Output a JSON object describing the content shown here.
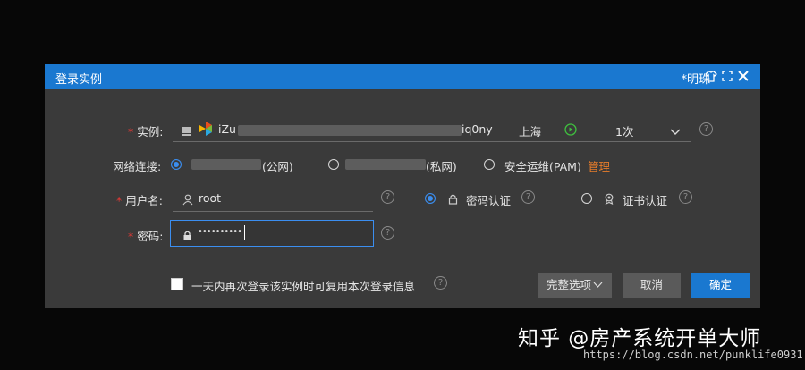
{
  "dialog": {
    "title": "登录实例",
    "user": "*明珠"
  },
  "instance": {
    "label": "实例:",
    "id_prefix": "iZu",
    "id_suffix": "iq0ny",
    "region": "上海",
    "count": "1次"
  },
  "network": {
    "label": "网络连接:",
    "public_label": "(公网)",
    "private_label": "(私网)",
    "pam_label": "安全运维(PAM)",
    "manage_link": "管理"
  },
  "username": {
    "label": "用户名:",
    "value": "root"
  },
  "auth": {
    "password_label": "密码认证",
    "cert_label": "证书认证"
  },
  "password": {
    "label": "密码:",
    "masked": "••••••••••"
  },
  "footer": {
    "remember_label": "一天内再次登录该实例时可复用本次登录信息",
    "options_button": "完整选项",
    "cancel_button": "取消",
    "confirm_button": "确定"
  },
  "watermark": {
    "text": "知乎 @房产系统开单大师",
    "url": "https://blog.csdn.net/punklife0931"
  },
  "colors": {
    "titlebar": "#1a78d0",
    "dialog_bg": "#3a3a3a",
    "accent": "#3b8ef0",
    "required": "#e53935",
    "link": "#e87d2a"
  },
  "icons": {
    "region": "play-circle-icon",
    "help": "question-circle-icon"
  }
}
